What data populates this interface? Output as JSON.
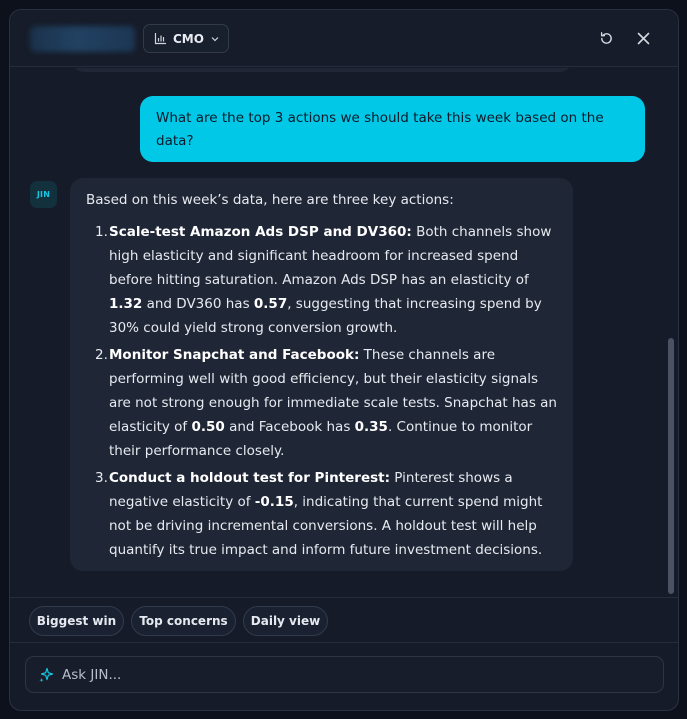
{
  "header": {
    "role_label": "CMO",
    "role_icon": "bar-chart-icon",
    "refresh_icon": "refresh-icon",
    "close_icon": "close-icon"
  },
  "conversation": {
    "user_message": "What are the top 3 actions we should take this week based on the data?",
    "assistant_avatar": "JIN",
    "assistant_intro": "Based on this week’s data, here are three key actions:",
    "actions": [
      {
        "number": "1.",
        "title": "Scale-test Amazon Ads DSP and DV360:",
        "text_a": " Both channels show high elasticity and significant headroom for increased spend before hitting saturation. Amazon Ads DSP has an elasticity of ",
        "value_1": "1.32",
        "text_b": " and DV360 has ",
        "value_2": "0.57",
        "text_c": ", suggesting that increasing spend by 30% could yield strong conversion growth."
      },
      {
        "number": "2.",
        "title": "Monitor Snapchat and Facebook:",
        "text_a": " These channels are performing well with good efficiency, but their elasticity signals are not strong enough for immediate scale tests. Snapchat has an elasticity of ",
        "value_1": "0.50",
        "text_b": " and Facebook has ",
        "value_2": "0.35",
        "text_c": ". Continue to monitor their performance closely."
      },
      {
        "number": "3.",
        "title": "Conduct a holdout test for Pinterest:",
        "text_a": " Pinterest shows a negative elasticity of ",
        "value_1": "-0.15",
        "text_b": ", indicating that current spend might not be driving incremental conversions. A holdout test will help quantify its true impact and inform future investment decisions."
      }
    ]
  },
  "suggestions": [
    "Biggest win",
    "Top concerns",
    "Daily view"
  ],
  "composer": {
    "placeholder": "Ask JIN...",
    "icon": "sparkle-icon"
  },
  "colors": {
    "accent": "#00c8e6",
    "background": "#151b28",
    "bubble": "#1f2636"
  }
}
